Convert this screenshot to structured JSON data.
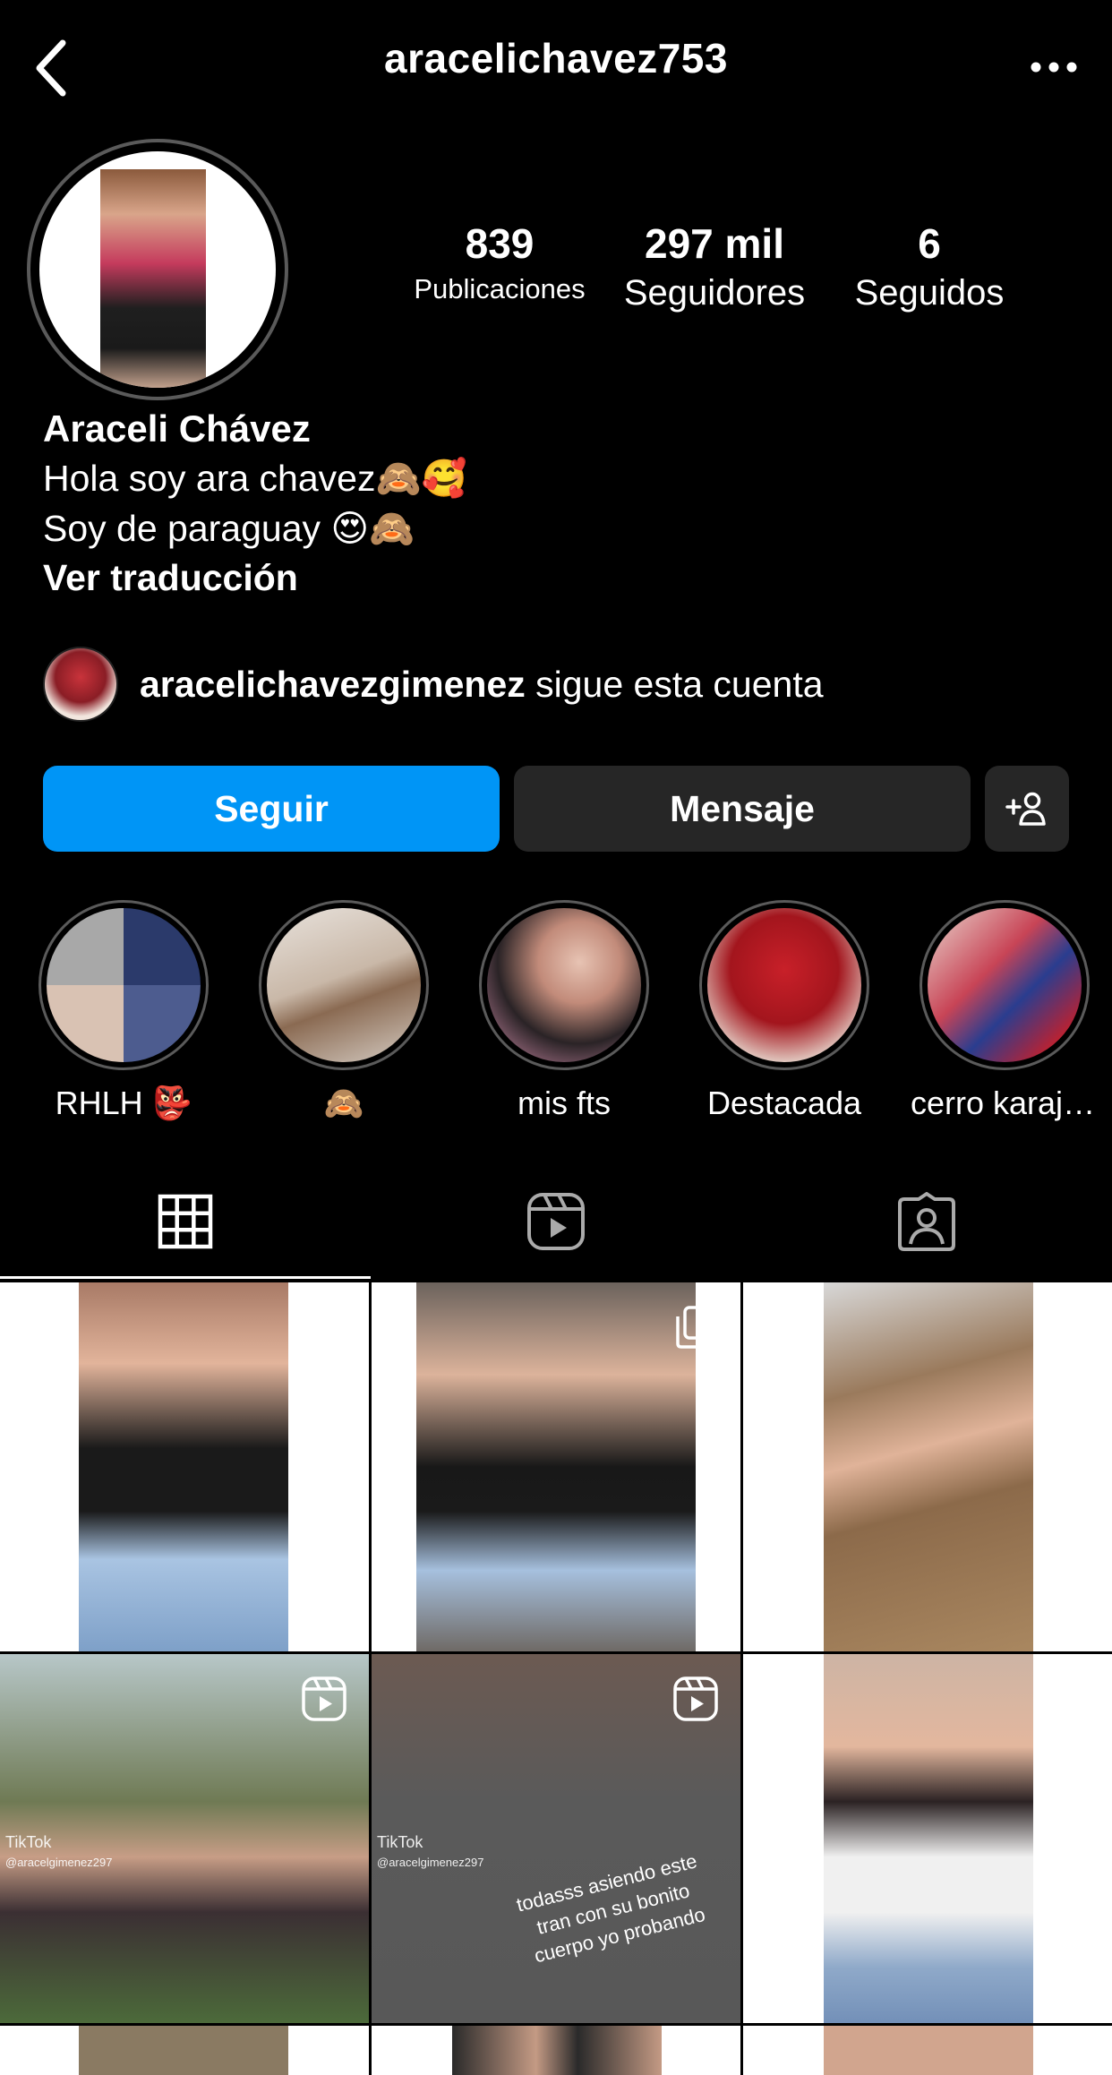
{
  "header": {
    "username": "aracelichavez753"
  },
  "profile": {
    "posts_count": "839",
    "posts_label": "Publicaciones",
    "followers_count": "297 mil",
    "followers_label": "Seguidores",
    "following_count": "6",
    "following_label": "Seguidos"
  },
  "bio": {
    "name": "Araceli Chávez",
    "line1": "Hola soy ara chavez🙈🥰",
    "line2": "Soy de paraguay 😍🙈",
    "translate": "Ver traducción"
  },
  "followed_by": {
    "username": "aracelichavezgimenez",
    "text": " sigue esta cuenta"
  },
  "actions": {
    "follow": "Seguir",
    "message": "Mensaje"
  },
  "highlights": [
    {
      "label": "RHLH 👺"
    },
    {
      "label": "🙈"
    },
    {
      "label": "mis fts"
    },
    {
      "label": "Destacada"
    },
    {
      "label": "cerro karajo..."
    }
  ],
  "grid": {
    "tiktok_mark": "TikTok",
    "post5_handle": "@aracelgimenez297",
    "post4_handle": "@aracelgimenez297",
    "post5_caption": "todasss asiendo este tran con su bonito cuerpo yo probando"
  },
  "colors": {
    "accent": "#0095f6",
    "button_dark": "#262626",
    "background": "#000000"
  }
}
